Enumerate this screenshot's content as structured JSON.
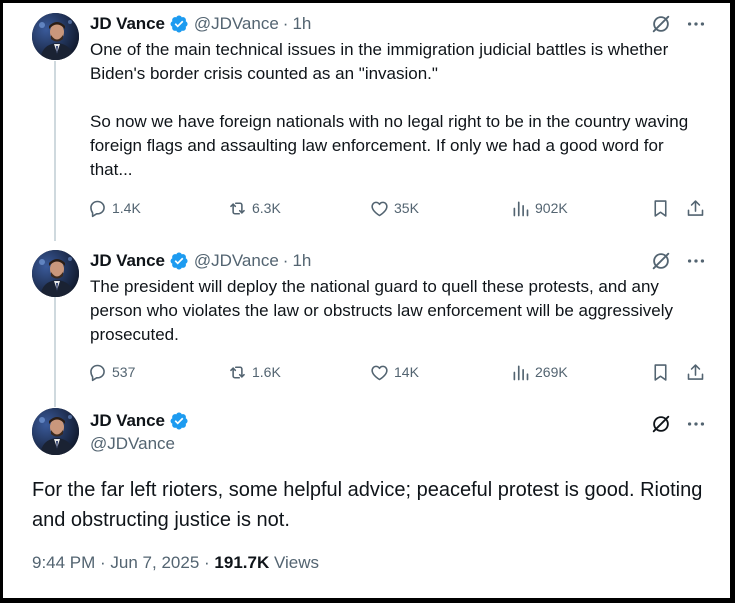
{
  "tweets": [
    {
      "name": "JD Vance",
      "handle": "@JDVance",
      "time": "1h",
      "text": "One of the main technical issues in the immigration judicial battles is whether Biden's border crisis counted as an \"invasion.\"\n\nSo now we have foreign nationals with no legal right to be in the country waving foreign flags and assaulting law enforcement. If only we had a good word for that...",
      "replies": "1.4K",
      "reposts": "6.3K",
      "likes": "35K",
      "views": "902K"
    },
    {
      "name": "JD Vance",
      "handle": "@JDVance",
      "time": "1h",
      "text": "The president will deploy the national guard to quell these protests, and any person who violates the law or obstructs law enforcement will be aggressively prosecuted.",
      "replies": "537",
      "reposts": "1.6K",
      "likes": "14K",
      "views": "269K"
    }
  ],
  "main": {
    "name": "JD Vance",
    "handle": "@JDVance",
    "text": "For the far left rioters, some helpful advice; peaceful protest is good. Rioting and obstructing justice is not.",
    "time": "9:44 PM · Jun 7, 2025",
    "views_count": "191.7K",
    "views_label": "Views"
  },
  "separator": "·",
  "colors": {
    "verified_blue": "#1d9bf0",
    "text": "#0f1419",
    "muted": "#536471",
    "thread_line": "#cfd9de"
  },
  "icons": [
    "verified-badge-icon",
    "grok-icon",
    "more-icon",
    "reply-icon",
    "repost-icon",
    "like-icon",
    "views-icon",
    "bookmark-icon",
    "share-icon"
  ]
}
